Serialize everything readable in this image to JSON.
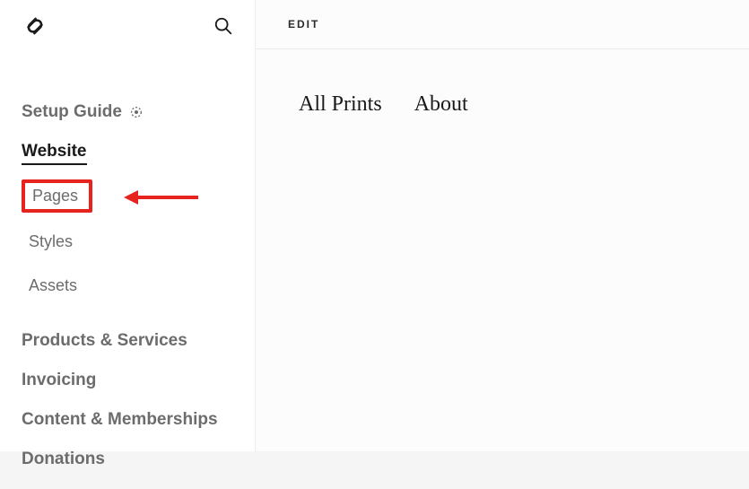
{
  "header": {
    "edit_label": "EDIT"
  },
  "sidebar": {
    "items": [
      {
        "label": "Setup Guide",
        "hasTargetIcon": true
      },
      {
        "label": "Website",
        "active": true
      },
      {
        "label": "Products & Services"
      },
      {
        "label": "Invoicing"
      },
      {
        "label": "Content & Memberships"
      },
      {
        "label": "Donations"
      }
    ],
    "website_subitems": [
      {
        "label": "Pages",
        "highlighted": true
      },
      {
        "label": "Styles"
      },
      {
        "label": "Assets"
      }
    ]
  },
  "preview": {
    "nav": [
      {
        "label": "All Prints"
      },
      {
        "label": "About"
      }
    ]
  },
  "annotation": {
    "arrow_color": "#e6231f",
    "highlight_box_color": "#e6231f"
  }
}
